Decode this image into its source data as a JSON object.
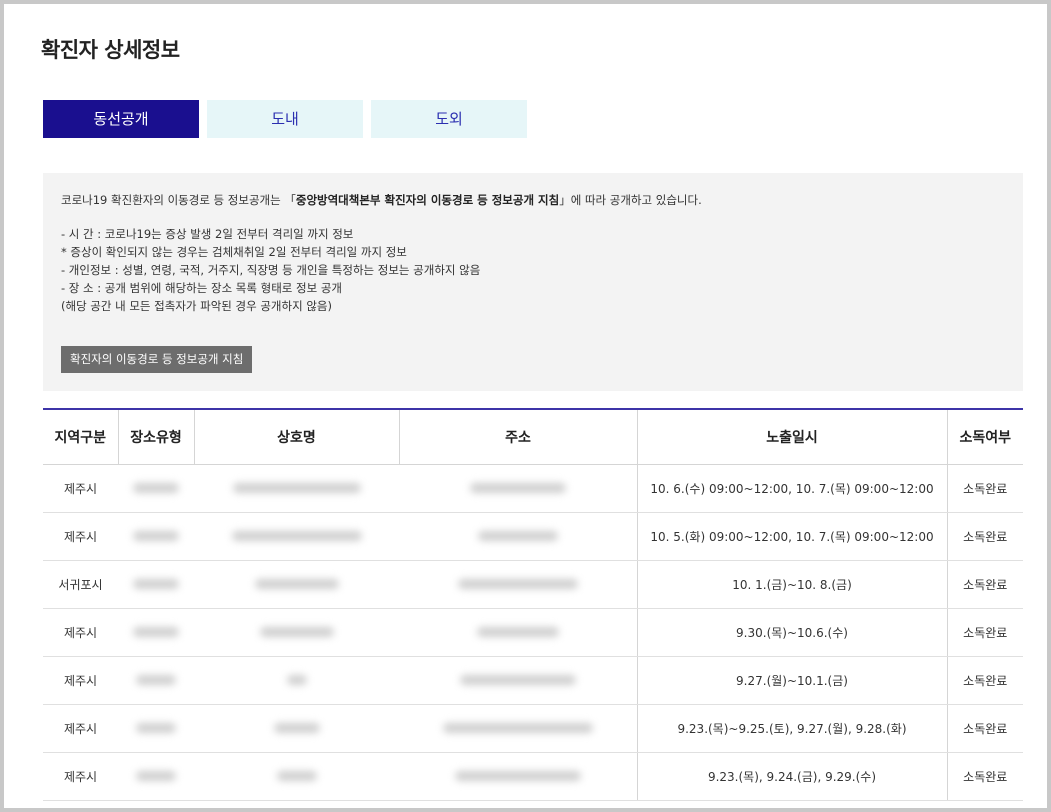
{
  "page": {
    "title": "확진자 상세정보"
  },
  "tabs": [
    {
      "label": "동선공개",
      "active": true
    },
    {
      "label": "도내",
      "active": false
    },
    {
      "label": "도외",
      "active": false
    }
  ],
  "info": {
    "intro_prefix": "코로나19 확진환자의 이동경로 등 정보공개는 「",
    "intro_bold": "중앙방역대책본부 확진자의 이동경로 등 정보공개 지침",
    "intro_suffix": "」에 따라 공개하고 있습니다.",
    "lines": [
      "- 시 간 : 코로나19는 증상 발생 2일 전부터 격리일 까지 정보",
      "* 증상이 확인되지 않는 경우는 검체채취일 2일 전부터 격리일 까지 정보",
      "- 개인정보 : 성별, 연령, 국적, 거주지, 직장명 등 개인을 특정하는 정보는 공개하지 않음",
      "- 장 소 : 공개 범위에 해당하는 장소 목록 형태로 정보 공개",
      "(해당 공간 내 모든 접촉자가 파악된 경우 공개하지 않음)"
    ],
    "guide_button": "확진자의 이동경로 등 정보공개 지침"
  },
  "table": {
    "headers": [
      "지역구분",
      "장소유형",
      "상호명",
      "주소",
      "노출일시",
      "소독여부"
    ],
    "rows": [
      {
        "region": "제주시",
        "exposure": "10. 6.(수) 09:00~12:00, 10. 7.(목) 09:00~12:00",
        "disinfection": "소독완료"
      },
      {
        "region": "제주시",
        "exposure": "10. 5.(화) 09:00~12:00, 10. 7.(목) 09:00~12:00",
        "disinfection": "소독완료"
      },
      {
        "region": "서귀포시",
        "exposure": "10. 1.(금)~10. 8.(금)",
        "disinfection": "소독완료"
      },
      {
        "region": "제주시",
        "exposure": "9.30.(목)~10.6.(수)",
        "disinfection": "소독완료"
      },
      {
        "region": "제주시",
        "exposure": "9.27.(월)~10.1.(금)",
        "disinfection": "소독완료"
      },
      {
        "region": "제주시",
        "exposure": "9.23.(목)~9.25.(토), 9.27.(월), 9.28.(화)",
        "disinfection": "소독완료"
      },
      {
        "region": "제주시",
        "exposure": "9.23.(목), 9.24.(금), 9.29.(수)",
        "disinfection": "소독완료"
      }
    ]
  }
}
